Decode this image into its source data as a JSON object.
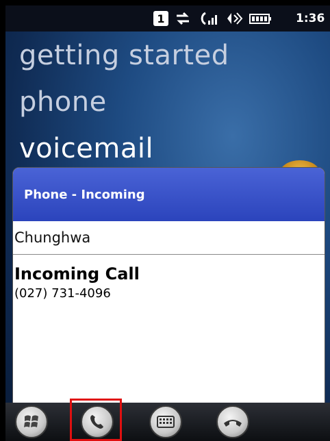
{
  "status_bar": {
    "sim_label": "1",
    "time": "1:36",
    "icons": [
      "sim-1-icon",
      "data-transfer-icon",
      "signal-strength-icon",
      "speaker-icon",
      "battery-icon"
    ]
  },
  "menu": {
    "items": [
      {
        "label": "getting started"
      },
      {
        "label": "phone"
      },
      {
        "label": "voicemail"
      }
    ]
  },
  "dialog": {
    "title": "Phone - Incoming",
    "carrier": "Chunghwa",
    "call_title": "Incoming Call",
    "call_number": "(027) 731-4096"
  },
  "taskbar": {
    "buttons": [
      {
        "name": "start-button",
        "icon": "windows-logo-icon"
      },
      {
        "name": "answer-call-button",
        "icon": "phone-answer-icon"
      },
      {
        "name": "keypad-button",
        "icon": "keypad-icon"
      },
      {
        "name": "end-call-button",
        "icon": "phone-hangup-icon"
      }
    ]
  },
  "colors": {
    "dialog_title_bg": "#2b44bc",
    "highlight": "#e01010"
  }
}
